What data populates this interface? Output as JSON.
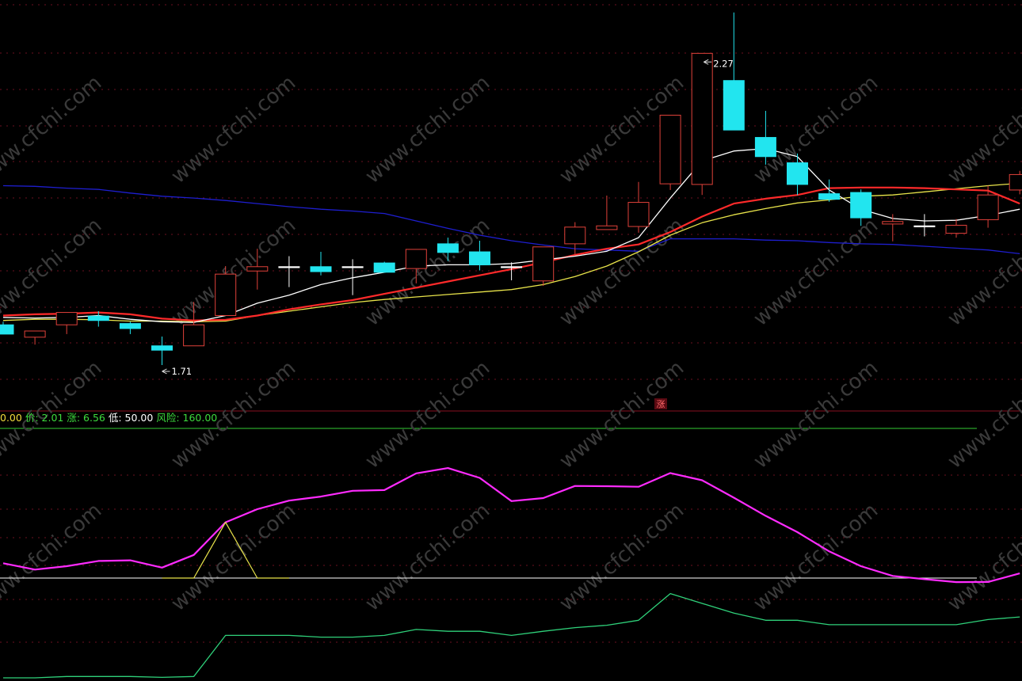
{
  "colors": {
    "background": "#000000",
    "grid": "#6b0f1f",
    "up_candle": "#e0413a",
    "down_candle": "#22e5ef",
    "ma_white": "#ffffff",
    "ma_red": "#ff2a2a",
    "ma_yellow": "#e8e34a",
    "ma_blue": "#1e1ecf",
    "osc_magenta": "#ff2bff",
    "osc_yellow": "#e8e34a",
    "baseline": "#ffffff",
    "green_line": "#2fd17a",
    "top_separator": "#33cc33",
    "legend_yellow": "#f2dc3c",
    "legend_green": "#3ddc3d",
    "legend_white": "#ffffff",
    "watermark": "#3a3a3a"
  },
  "watermark_text": "www.cfchi.com",
  "price_labels": {
    "high": "2.27",
    "low": "1.71"
  },
  "up_marker": "涨",
  "legend": [
    {
      "text": "0.00",
      "color": "legend_yellow"
    },
    {
      "text": " 价: ",
      "color": "legend_green"
    },
    {
      "text": "2.01",
      "color": "legend_green"
    },
    {
      "text": " 涨: ",
      "color": "legend_green"
    },
    {
      "text": "6.56",
      "color": "legend_green"
    },
    {
      "text": " 低: ",
      "color": "legend_white"
    },
    {
      "text": "50.00",
      "color": "legend_white"
    },
    {
      "text": " 风险: ",
      "color": "legend_green"
    },
    {
      "text": "160.00",
      "color": "legend_green"
    }
  ],
  "chart_data": [
    {
      "type": "candlestick",
      "title": "",
      "ylim": [
        1.66,
        2.29
      ],
      "candles": [
        {
          "o": 1.775,
          "h": 1.78,
          "l": 1.76,
          "c": 1.76
        },
        {
          "o": 1.755,
          "h": 1.765,
          "l": 1.743,
          "c": 1.765
        },
        {
          "o": 1.775,
          "h": 1.795,
          "l": 1.76,
          "c": 1.795
        },
        {
          "o": 1.789,
          "h": 1.797,
          "l": 1.772,
          "c": 1.782
        },
        {
          "o": 1.777,
          "h": 1.78,
          "l": 1.76,
          "c": 1.769
        },
        {
          "o": 1.741,
          "h": 1.756,
          "l": 1.71,
          "c": 1.734
        },
        {
          "o": 1.741,
          "h": 1.812,
          "l": 1.741,
          "c": 1.775
        },
        {
          "o": 1.79,
          "h": 1.87,
          "l": 1.79,
          "c": 1.857
        },
        {
          "o": 1.862,
          "h": 1.898,
          "l": 1.832,
          "c": 1.869
        },
        {
          "o": 1.869,
          "h": 1.886,
          "l": 1.836,
          "c": 1.869
        },
        {
          "o": 1.869,
          "h": 1.893,
          "l": 1.855,
          "c": 1.861
        },
        {
          "o": 1.869,
          "h": 1.881,
          "l": 1.823,
          "c": 1.869
        },
        {
          "o": 1.875,
          "h": 1.877,
          "l": 1.86,
          "c": 1.86
        },
        {
          "o": 1.866,
          "h": 1.897,
          "l": 1.842,
          "c": 1.897
        },
        {
          "o": 1.906,
          "h": 1.916,
          "l": 1.878,
          "c": 1.892
        },
        {
          "o": 1.893,
          "h": 1.911,
          "l": 1.863,
          "c": 1.872
        },
        {
          "o": 1.869,
          "h": 1.876,
          "l": 1.847,
          "c": 1.869
        },
        {
          "o": 1.846,
          "h": 1.9,
          "l": 1.838,
          "c": 1.901
        },
        {
          "o": 1.906,
          "h": 1.941,
          "l": 1.888,
          "c": 1.933
        },
        {
          "o": 1.929,
          "h": 1.984,
          "l": 1.929,
          "c": 1.935
        },
        {
          "o": 1.934,
          "h": 2.006,
          "l": 1.924,
          "c": 1.973
        },
        {
          "o": 2.003,
          "h": 2.096,
          "l": 1.993,
          "c": 2.114
        },
        {
          "o": 2.002,
          "h": 2.2,
          "l": 1.985,
          "c": 2.214
        },
        {
          "o": 2.17,
          "h": 2.28,
          "l": 2.09,
          "c": 2.09
        },
        {
          "o": 2.078,
          "h": 2.121,
          "l": 2.034,
          "c": 2.047
        },
        {
          "o": 2.037,
          "h": 2.052,
          "l": 1.985,
          "c": 2.002
        },
        {
          "o": 1.987,
          "h": 2.01,
          "l": 1.974,
          "c": 1.978
        },
        {
          "o": 1.989,
          "h": 1.994,
          "l": 1.935,
          "c": 1.948
        },
        {
          "o": 1.938,
          "h": 1.954,
          "l": 1.91,
          "c": 1.942
        },
        {
          "o": 1.935,
          "h": 1.954,
          "l": 1.918,
          "c": 1.935
        },
        {
          "o": 1.923,
          "h": 1.946,
          "l": 1.916,
          "c": 1.936
        },
        {
          "o": 1.945,
          "h": 2.0,
          "l": 1.932,
          "c": 1.985
        },
        {
          "o": 1.993,
          "h": 2.024,
          "l": 1.986,
          "c": 2.018
        }
      ],
      "moving_averages": [
        {
          "color": "ma_white",
          "values": [
            1.787,
            1.786,
            1.787,
            1.79,
            1.784,
            1.78,
            1.779,
            1.79,
            1.81,
            1.823,
            1.84,
            1.851,
            1.86,
            1.87,
            1.872,
            1.872,
            1.874,
            1.88,
            1.886,
            1.894,
            1.916,
            1.98,
            2.04,
            2.056,
            2.06,
            2.047,
            1.993,
            1.962,
            1.947,
            1.943,
            1.944,
            1.952,
            1.962
          ]
        },
        {
          "color": "ma_red",
          "values": [
            1.79,
            1.792,
            1.793,
            1.795,
            1.792,
            1.785,
            1.782,
            1.783,
            1.79,
            1.8,
            1.808,
            1.815,
            1.825,
            1.835,
            1.845,
            1.855,
            1.865,
            1.876,
            1.888,
            1.898,
            1.905,
            1.925,
            1.95,
            1.971,
            1.979,
            1.985,
            1.996,
            1.997,
            1.997,
            1.996,
            1.994,
            1.992,
            1.971
          ]
        },
        {
          "color": "ma_yellow",
          "values": [
            1.782,
            1.784,
            1.784,
            1.783,
            1.781,
            1.781,
            1.78,
            1.781,
            1.79,
            1.797,
            1.804,
            1.811,
            1.816,
            1.82,
            1.824,
            1.828,
            1.832,
            1.84,
            1.853,
            1.87,
            1.893,
            1.92,
            1.94,
            1.953,
            1.963,
            1.972,
            1.977,
            1.983,
            1.985,
            1.99,
            1.995,
            2.0,
            2.004
          ]
        },
        {
          "color": "ma_blue",
          "values": [
            2.0,
            1.999,
            1.996,
            1.994,
            1.988,
            1.983,
            1.98,
            1.976,
            1.971,
            1.966,
            1.962,
            1.959,
            1.955,
            1.943,
            1.931,
            1.92,
            1.911,
            1.904,
            1.898,
            1.896,
            1.894,
            1.914,
            1.914,
            1.914,
            1.912,
            1.911,
            1.908,
            1.906,
            1.905,
            1.902,
            1.899,
            1.896,
            1.89
          ]
        }
      ]
    },
    {
      "type": "line",
      "title": "",
      "ylim": [
        0,
        100
      ],
      "series": [
        {
          "color": "osc_magenta",
          "values": [
            22.0,
            12.6,
            17.6,
            25.4,
            26.3,
            15.5,
            34.3,
            82.8,
            102.4,
            115.1,
            121.0,
            129.6,
            130.7,
            155.5,
            163.4,
            148.8,
            114.3,
            118.8,
            136.8,
            136.5,
            135.6,
            156.0,
            145.3,
            119.4,
            92.5,
            68.2,
            39.6,
            17.6,
            3.2,
            -1.6,
            -6.0,
            -5.8,
            6.9
          ]
        },
        {
          "color": "osc_yellow",
          "values": [
            null,
            null,
            null,
            null,
            null,
            0,
            0,
            82.8,
            0,
            0,
            null,
            null,
            null,
            null,
            null,
            null,
            null,
            null,
            null,
            null,
            null,
            null,
            null,
            null,
            null,
            null,
            null,
            null,
            null,
            null,
            null,
            null,
            null
          ]
        }
      ]
    },
    {
      "type": "line",
      "title": "",
      "series": [
        {
          "color": "green_line",
          "values": [
            0.0,
            0.0,
            1.2,
            1.2,
            1.2,
            0.4,
            1.2,
            37.2,
            37.2,
            37.2,
            35.7,
            35.7,
            37.2,
            42.4,
            40.8,
            40.8,
            37.2,
            40.8,
            44.0,
            46.1,
            50.5,
            73.9,
            65.3,
            56.8,
            50.5,
            50.5,
            46.6,
            46.6,
            46.6,
            46.6,
            46.6,
            51.1,
            53.4
          ]
        }
      ]
    }
  ]
}
